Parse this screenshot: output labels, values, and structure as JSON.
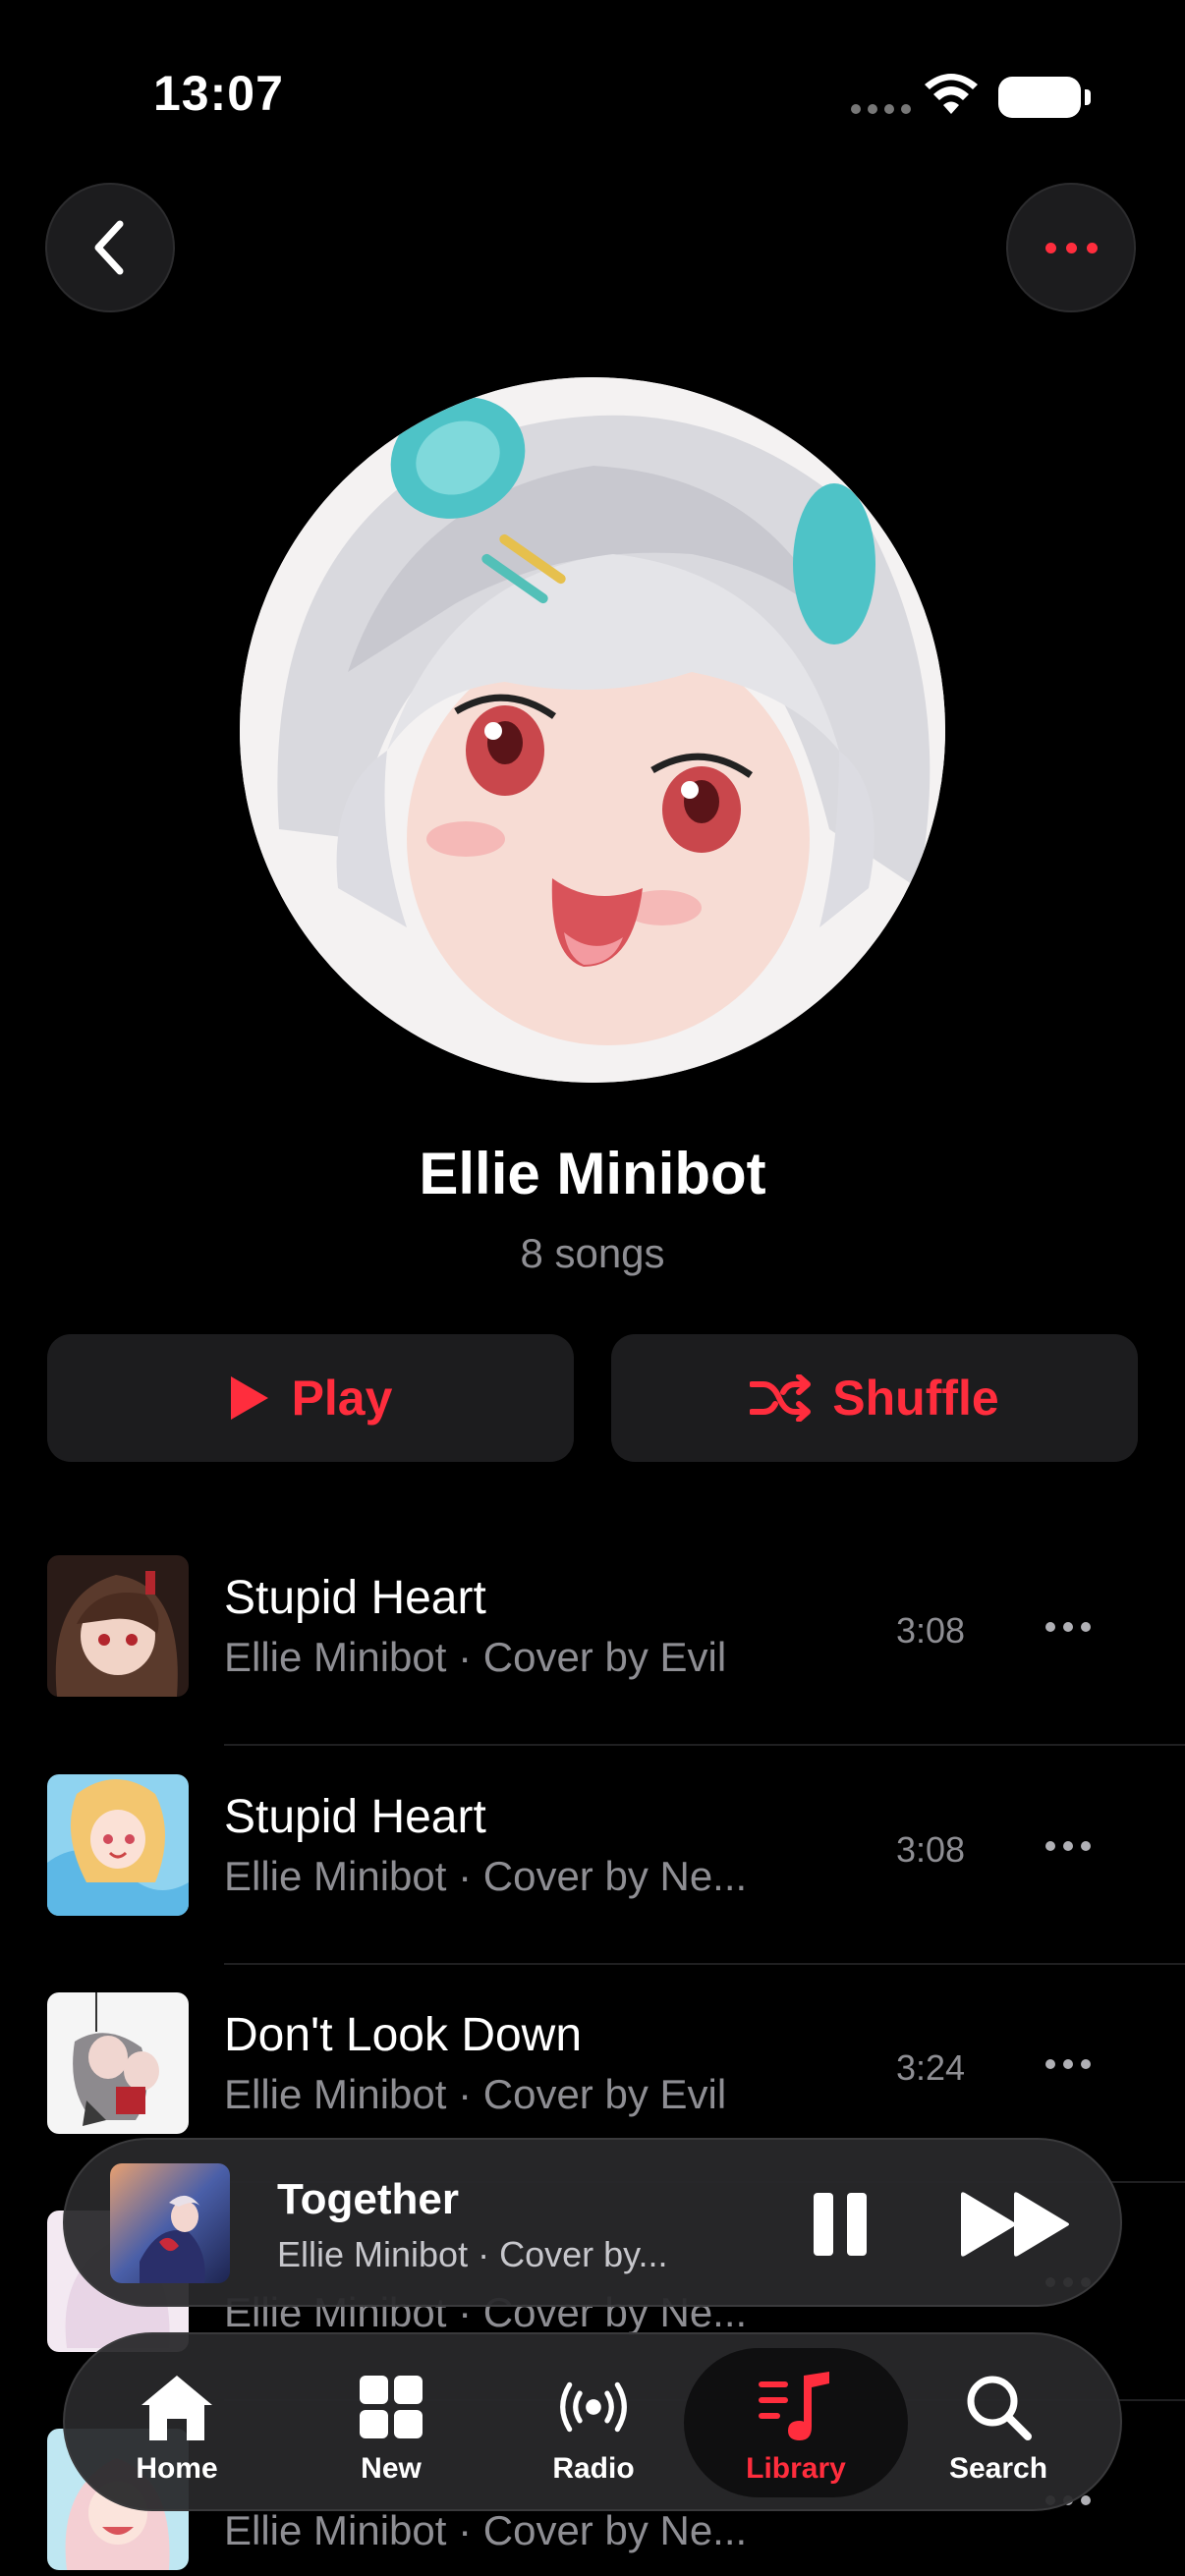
{
  "status_bar": {
    "time": "13:07"
  },
  "artist": {
    "name": "Ellie Minibot",
    "song_count": "8 songs"
  },
  "actions": {
    "play_label": "Play",
    "shuffle_label": "Shuffle"
  },
  "songs": [
    {
      "title": "Stupid Heart",
      "subtitle": "Ellie Minibot · Cover by Evil",
      "duration": "3:08"
    },
    {
      "title": "Stupid Heart",
      "subtitle": "Ellie Minibot · Cover by Ne...",
      "duration": "3:08"
    },
    {
      "title": "Don't Look Down",
      "subtitle": "Ellie Minibot · Cover by Evil",
      "duration": "3:24"
    },
    {
      "title": "",
      "subtitle": "Ellie Minibot · Cover by Ne...",
      "duration": ""
    },
    {
      "title": "",
      "subtitle": "Ellie Minibot · Cover by Ne...",
      "duration": ""
    }
  ],
  "now_playing": {
    "title": "Together",
    "subtitle": "Ellie Minibot · Cover by..."
  },
  "tabs": [
    {
      "label": "Home",
      "icon": "home-icon"
    },
    {
      "label": "New",
      "icon": "grid-icon"
    },
    {
      "label": "Radio",
      "icon": "radio-icon"
    },
    {
      "label": "Library",
      "icon": "music-note-icon",
      "active": true
    },
    {
      "label": "Search",
      "icon": "search-icon"
    }
  ],
  "colors": {
    "accent": "#ff2d3d",
    "background": "#000000",
    "card": "#1c1c1e",
    "secondary_text": "#8e8e93"
  }
}
